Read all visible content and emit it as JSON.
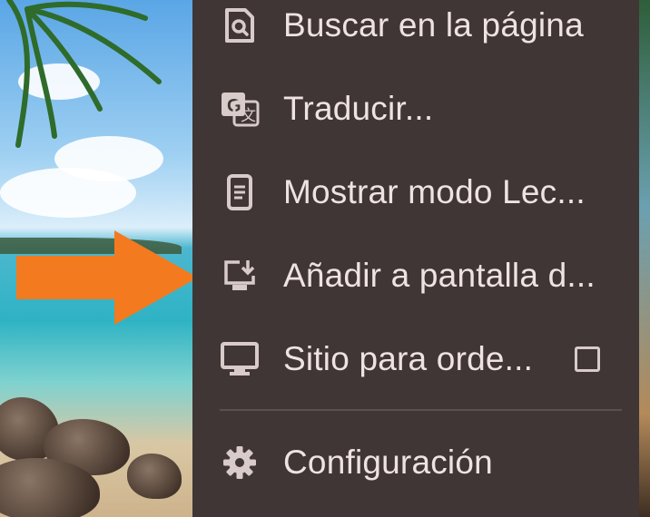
{
  "menu": {
    "items": [
      {
        "label": "Buscar en la página",
        "icon": "find-in-page-icon"
      },
      {
        "label": "Traducir...",
        "icon": "translate-icon"
      },
      {
        "label": "Mostrar modo Lec...",
        "icon": "reader-mode-icon"
      },
      {
        "label": "Añadir a pantalla d...",
        "icon": "add-to-home-screen-icon"
      },
      {
        "label": "Sitio para orde...",
        "icon": "desktop-icon",
        "checkbox_checked": false
      },
      {
        "label": "Configuración",
        "icon": "settings-gear-icon"
      }
    ]
  },
  "colors": {
    "menu_background": "#3f3635",
    "menu_text": "#efe3e1",
    "arrow": "#f47a1f"
  }
}
